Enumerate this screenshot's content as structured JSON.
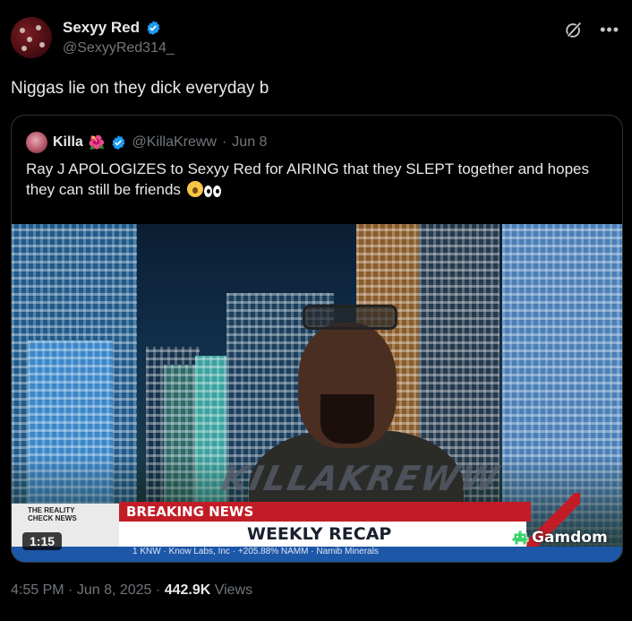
{
  "author": {
    "name": "Sexyy Red",
    "handle": "@SexyyRed314_",
    "verified": true,
    "avatar": "avatar"
  },
  "post": {
    "text": "Niggas lie on they dick everyday b"
  },
  "quoted": {
    "name": "Killa",
    "name_emoji": "🌺",
    "handle": "@KillaKreww",
    "separator": "·",
    "date": "Jun 8",
    "text": "Ray J APOLOGIZES to Sexyy Red for AIRING that they SLEPT together and hopes they can still be friends",
    "text_emojis": [
      "hushed-face-icon",
      "eyes-icon"
    ],
    "video": {
      "duration": "1:15",
      "watermark": "KILLAKREWW",
      "breaking_label": "BREAKING NEWS",
      "recap_label": "WEEKLY RECAP",
      "reality_label": "THE REALITY CHECK NEWS",
      "ticker": "1 KNW · Know Labs, Inc · +205.88% NAMM · Namib Minerals",
      "sponsor": "Gamdom"
    }
  },
  "footer": {
    "time": "4:55 PM",
    "sep1": "·",
    "date": "Jun 8, 2025",
    "sep2": "·",
    "views_count": "442.9K",
    "views_label": "Views"
  },
  "colors": {
    "background": "#000000",
    "verified": "#1d9bf0",
    "muted": "#71767b",
    "breaking_red": "#c21d26"
  }
}
